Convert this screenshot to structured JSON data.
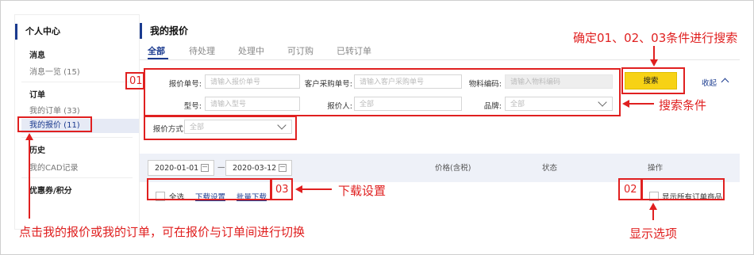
{
  "sidebar": {
    "title": "个人中心",
    "sections": [
      {
        "heading": "消息",
        "items": [
          "消息一览 (15)"
        ]
      },
      {
        "heading": "订单",
        "items": [
          "我的订单 (33)",
          "我的报价 (11)"
        ]
      },
      {
        "heading": "历史",
        "items": [
          "我的CAD记录"
        ]
      },
      {
        "heading": "优惠券/积分",
        "items": []
      }
    ]
  },
  "main": {
    "title": "我的报价",
    "tabs": [
      "全部",
      "待处理",
      "处理中",
      "可订购",
      "已转订单"
    ],
    "filters": {
      "quote_no": {
        "label": "报价单号:",
        "placeholder": "请输入报价单号"
      },
      "customer_po": {
        "label": "客户采购单号:",
        "placeholder": "请输入客户采购单号"
      },
      "material_code": {
        "label": "物料编码:",
        "placeholder": "请输入物料编码"
      },
      "model": {
        "label": "型号:",
        "placeholder": "请输入型号"
      },
      "quoter": {
        "label": "报价人:",
        "value": "全部"
      },
      "brand": {
        "label": "品牌:",
        "value": "全部"
      },
      "quote_method": {
        "label": "报价方式:",
        "value": "全部"
      }
    },
    "search_label": "搜索",
    "collapse_label": "收起",
    "date_from": "2020-01-01",
    "date_sep": "—",
    "date_to": "2020-03-12",
    "columns": [
      "价格(含税)",
      "状态",
      "操作"
    ],
    "select_all": "全选",
    "download_settings": "下载设置",
    "batch_download": "批量下载",
    "show_all_items": "显示所有订单商品"
  },
  "annotations": {
    "n01": "01",
    "n02": "02",
    "n03": "03",
    "top_note": "确定01、02、03条件进行搜索",
    "search_conditions": "搜索条件",
    "download_settings": "下载设置",
    "display_options": "显示选项",
    "bottom_note": "点击我的报价或我的订单，可在报价与订单间进行切换"
  },
  "colors": {
    "accent": "#1a3a8f",
    "annotation": "#e02020",
    "search_button": "#f7d215"
  }
}
